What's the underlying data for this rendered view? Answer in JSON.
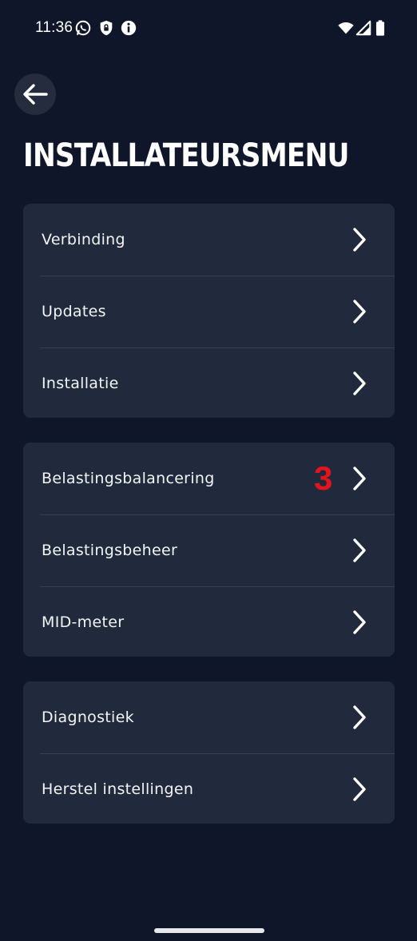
{
  "status_bar": {
    "time": "11:36",
    "left_icons": [
      "whatsapp-icon",
      "vpn-lock-icon",
      "info-icon"
    ],
    "right_icons": [
      "wifi-icon",
      "cell-signal-icon",
      "battery-icon"
    ]
  },
  "header": {
    "back_icon": "arrow-left-icon",
    "title": "INSTALLATEURSMENU"
  },
  "groups": [
    {
      "items": [
        {
          "label": "Verbinding"
        },
        {
          "label": "Updates"
        },
        {
          "label": "Installatie"
        }
      ]
    },
    {
      "items": [
        {
          "label": "Belastingsbalancering",
          "badge": "3"
        },
        {
          "label": "Belastingsbeheer"
        },
        {
          "label": "MID-meter"
        }
      ]
    },
    {
      "items": [
        {
          "label": "Diagnostiek"
        },
        {
          "label": "Herstel instellingen"
        }
      ]
    }
  ],
  "colors": {
    "background": "#10162a",
    "card": "#212a3c",
    "divider": "#363f52",
    "badge": "#e3141d"
  }
}
